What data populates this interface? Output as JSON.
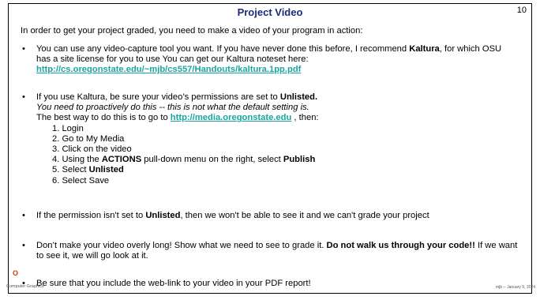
{
  "slide": {
    "title": "Project Video",
    "page_number": "10",
    "intro": "In order to get your project graded, you need to make a video of your program in action:",
    "bullet1": {
      "text_a": "You can use any video-capture tool you want.  If you have never done this before, I recommend ",
      "bold": "Kaltura",
      "text_b": ", for which OSU has a site license for you to use You can get our Kaltura noteset here:",
      "link": "http://cs.oregonstate.edu/~mjb/cs557/Handouts/kaltura.1pp.pdf"
    },
    "bullet2": {
      "text_a": "If you use Kaltura, be sure your video’s permissions are set to ",
      "bold": "Unlisted.",
      "italic": "You need to proactively do this -- this is not what the default setting is.",
      "best_way": "The best way to do this is to go to  ",
      "link": "http://media.oregonstate.edu",
      "then": " , then:",
      "steps": {
        "s1": "1. Login",
        "s2": "2. Go to My Media",
        "s3": "3. Click on the video",
        "s4_a": "4. Using the ",
        "s4_bold1": "ACTIONS",
        "s4_b": " pull-down menu on the right, select ",
        "s4_bold2": "Publish",
        "s5_a": "5. Select ",
        "s5_bold": "Unlisted",
        "s6": "6. Select Save"
      }
    },
    "bullet3": {
      "text_a": "If the permission isn't set to ",
      "bold": "Unlisted",
      "text_b": ", then we won't be able to see it and we can't grade your project"
    },
    "bullet4": {
      "text_a": "Don’t make your video overly long!  Show what we need to see to grade it.  ",
      "bold": "Do not walk us through your code!!",
      "text_b": "  If we want to see it, we will go look at it."
    },
    "bullet5": {
      "text": "Be sure that you include the web-link to your video in your PDF report!"
    },
    "footer": {
      "logo": "O",
      "left": "Computer Graphics",
      "right": "mjb -- January 9, 2024"
    }
  }
}
